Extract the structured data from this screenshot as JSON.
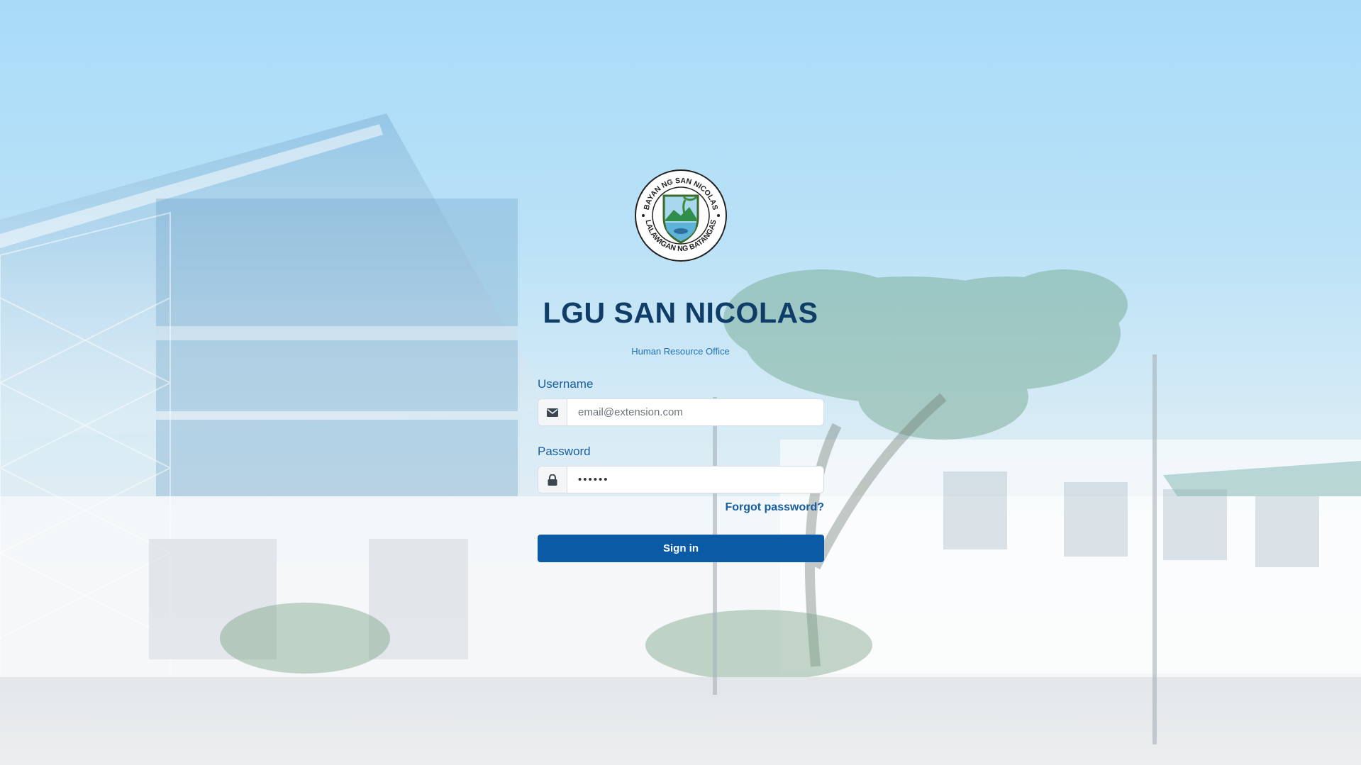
{
  "brand": {
    "title": "LGU SAN NICOLAS",
    "subtitle": "Human Resource Office",
    "seal_top_text": "BAYAN NG SAN NICOLAS",
    "seal_bottom_text": "LALAWIGAN NG BATANGAS"
  },
  "form": {
    "username_label": "Username",
    "username_placeholder": "email@extension.com",
    "username_icon": "envelope-icon",
    "password_label": "Password",
    "password_value": "••••••",
    "password_icon": "lock-icon",
    "forgot_label": "Forgot password?",
    "signin_label": "Sign in"
  },
  "colors": {
    "primary": "#0b5aa6",
    "title": "#0f3d68",
    "link": "#175da0"
  }
}
